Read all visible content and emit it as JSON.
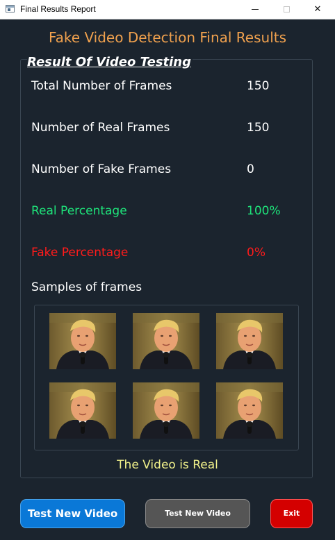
{
  "window": {
    "title": "Final Results Report",
    "app_icon": "window-app-icon",
    "controls": [
      "minimize-icon",
      "maximize-icon",
      "close-icon"
    ]
  },
  "heading": "Fake Video Detection Final Results",
  "section_title": "Result Of Video Testing",
  "stats": [
    {
      "label": "Total Number of Frames",
      "value": "150"
    },
    {
      "label": "Number of Real Frames",
      "value": "150"
    },
    {
      "label": "Number of Fake Frames",
      "value": "0"
    },
    {
      "label": "Real Percentage",
      "value": "100%"
    },
    {
      "label": "Fake Percentage",
      "value": "0%"
    }
  ],
  "samples": {
    "label": "Samples of frames",
    "count": 6
  },
  "verdict": "The Video is Real",
  "buttons": {
    "test_primary": "Test New Video",
    "test_secondary": "Test New Video",
    "exit": "Exit"
  },
  "colors": {
    "background": "#1b242e",
    "heading": "#f0a14e",
    "real": "#1ee37a",
    "fake": "#ff1b1b",
    "verdict": "#f0f08a",
    "primary_button": "#0a78d7",
    "secondary_button": "#555555",
    "exit_button": "#d40000"
  }
}
